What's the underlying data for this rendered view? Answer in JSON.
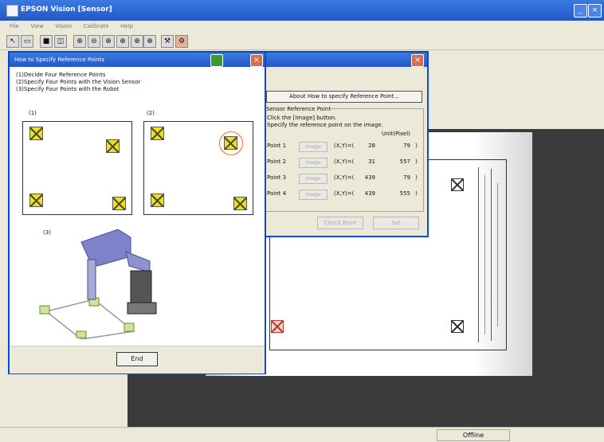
{
  "window": {
    "title": "EPSON Vision [Sensor]",
    "min_symbol": "_",
    "close_symbol": "×"
  },
  "menu": [
    "File",
    "View",
    "Vision",
    "Calibrate",
    "Help"
  ],
  "toolbar_icons": [
    "pointer-icon",
    "image-icon",
    "camera-icon",
    "zoom-in-icon",
    "zoom-out-icon",
    "zoom-fit-icon",
    "zoom-reset-icon",
    "zoom-area-icon",
    "tool-icon",
    "gear-icon"
  ],
  "status": {
    "text": "Offline"
  },
  "help_dialog": {
    "title": "How to Specify Reference Points",
    "steps": [
      "(1)Decide Four Reference Points",
      "(2)Specify Four Points with the Vision Sensor",
      "(3)Specify Four Points with the Robot"
    ],
    "panel1_label": "(1)",
    "panel2_label": "(2)",
    "panel3_label": "(3)",
    "close_symbol": "×",
    "end_button": "End"
  },
  "point_dialog": {
    "about_button": "About How to specify Reference Point...",
    "group_title": "Sensor Reference Point",
    "instructions": [
      "Click the [Image] button.",
      "Specify the reference point on the image."
    ],
    "unit_header": "Unit(Pixel)",
    "close_symbol": "×",
    "points": [
      {
        "label": "Point 1",
        "button": "Image",
        "coord_label": "(X,Y)=(",
        "x": "28",
        "y": "79",
        "suffix": ")"
      },
      {
        "label": "Point 2",
        "button": "Image",
        "coord_label": "(X,Y)=(",
        "x": "31",
        "y": "557",
        "suffix": ")"
      },
      {
        "label": "Point 3",
        "button": "Image",
        "coord_label": "(X,Y)=(",
        "x": "439",
        "y": "79",
        "suffix": ")"
      },
      {
        "label": "Point 4",
        "button": "Image",
        "coord_label": "(X,Y)=(",
        "x": "439",
        "y": "555",
        "suffix": ")"
      }
    ],
    "buttons": {
      "check": "Check Point",
      "set": "Set"
    }
  }
}
